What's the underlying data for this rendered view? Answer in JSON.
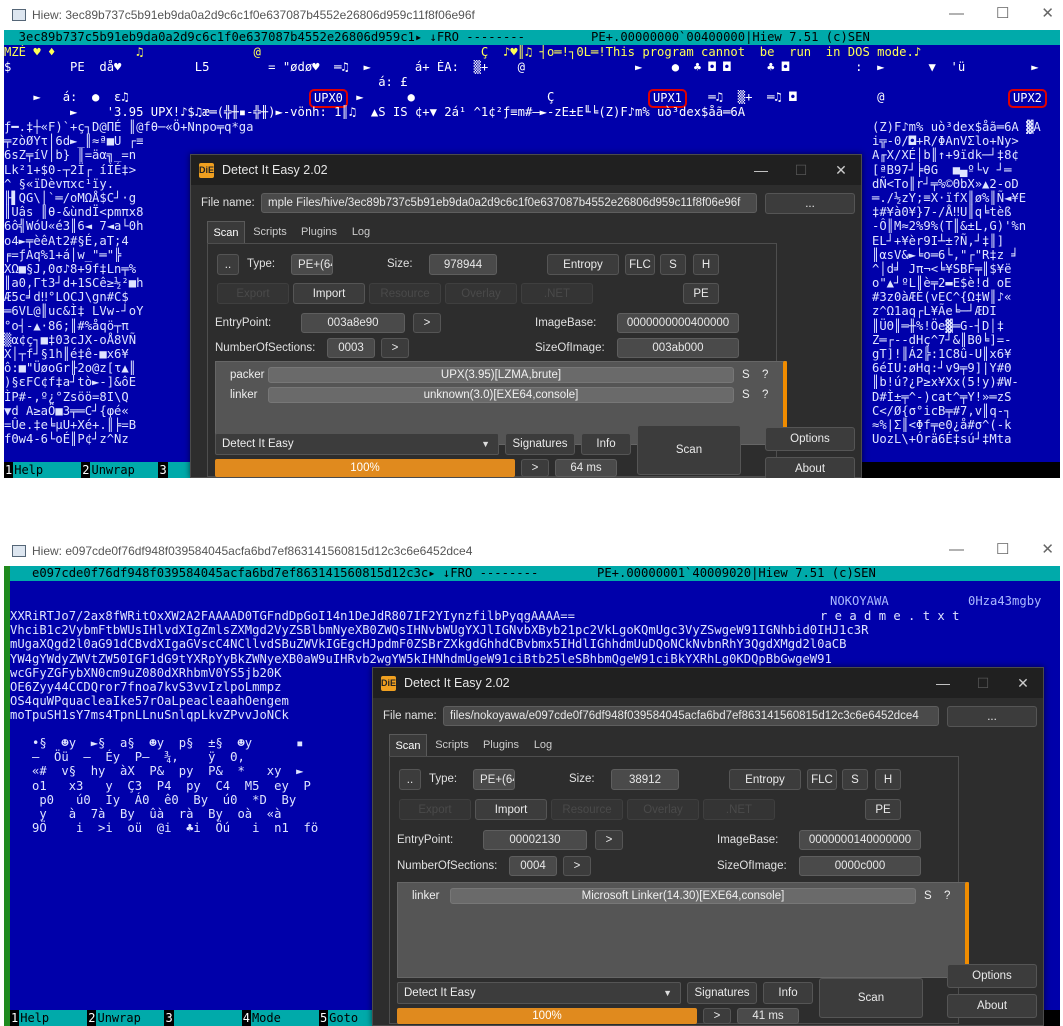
{
  "panel1": {
    "window_title": "Hiew: 3ec89b737c5b91eb9da0a2d9c6c1f0e637087b4552e26806d959c11f8f06e96f",
    "hiew_header": "  3ec89b737c5b91eb9da0a2d9c6c1f0e637087b4552e26806d959c1▸ ↓FRO --------         PE+.00000000`00400000|Hiew 7.51 (c)SEN",
    "hiew_lines": [
      "MZÉ ♥ ♦           ♫               @                              Ç  ♪♥║♫ ┤o═!┐0L═!This program cannot  be  run  in DOS mode.♪",
      "$        PE  då♥          L5        = \"ødø♥  ═♫  ►      á+ ÉA:  ▒+    @               ►    ●  ♣ ◘ ◘     ♣ ◘         :  ►      ▼  'ü         ►",
      "                                                   á: £"
    ],
    "upx_labels": [
      "UPX0",
      "UPX1",
      "UPX2"
    ],
    "upx_line": "    ►   á:  ●  ε♫                           á+  ►      ●                  Ç                     ═♫  ▒+  ═♫ ◘           @",
    "garbage_line": "         ►    '3.95 UPX!♪$♫æ═(╬╫▪-╬╫)►-vönh: 1║♫  ▲S IS ¢+▼ 2á¹ ^1¢²ƒ≡m#—►-zE±E╙╘(Z)F♪m% uò³dex$åã═6A",
    "garbage_left": [
      "ƒ━.‡┼«F)`+ç┐D@ΠÉ ║@fθ─«Ö+Nnpo╤q*ga",
      "╤zòØYτ│6d►_║≈ª■U ┌≡",
      "6sZ╤íV│b} ║=äα╗_=n",
      "Lk²1+$0-┬2Ï┌ íÌÉ‡>",
      "^ §«ïDèvπxc¹ïy.",
      "╟▌QG\\│`═/oMΩÅ$C┘·g",
      "║Uâs ║θ-&ùndÏ<pmπx8",
      "6ô╣WóU«é3║6◄ 7◄a└0h",
      "o4►╤èêAt2#§É,aT;4",
      "╒=ƒAq%1+á│w_\"═\"╠",
      "XΩ■§J,0σ♪8+9f‡Ln╤%",
      "║a0,Γt3┘d+1SCê≥½²■h",
      "Æ5c╛d‼°LOCJ\\gn#C$",
      "═6VL@║uc&Ì‡ LVw-┘oY",
      "°o┤-▲·86;║#%åqö┬π",
      "▒α¢ç┐■‡03cJX-oÅ8VÑ",
      "X│┬f┘§1h║é‡ê-■x6¥",
      "ô:■\"ÜøoGr╟2o@z[τ▲║",
      ")§εFC¢f‡a┘tò►-]&ôE",
      "ÌP#-,º¿°Zsöö=8I\\Q",
      "▼d A≥aÖ■3╤═C┘{φé«",
      "=Ûe.‡e╘µU+Xé+.║╞=B",
      "fΘw4-6└οÉ║P¢┘z^Nz"
    ],
    "garbage_right": [
      "(Z)F♪m% uò³dex$åã═6A ▓A",
      "i╦-0/◘+R/ΦAnVΣlo+Ny>",
      "A╓X/XÉ│b║↑+9ïdk─┘‡8¢",
      "[ªB97┘╞θG  ■▄º└v ┘═",
      "dÑ<To║r┘╤%©ΘbX»▲2-oD",
      "═./½zY;≡X·ïfX║ø%║Ñ◄¥E",
      "‡#¥à0¥}7-/Å‼U║q╘tèß",
      "-Ô║M≈2%9%(T║&±L,G)'%n",
      "EL┘+¥èr9I┴±?Ñ,┘‡║]",
      "║αsV&►╘o═6└,\"┌\"R‡z ╛",
      "^│d╛ Jπ¬<╘¥SBF╤║$¥ë",
      "o\"▲┘ºL║è╤2▬E$è!d oE",
      "#3z0àÆÉ(vEC^{Ω‡W║♪«",
      "z^Ω1aq┌L¥Ãe╘─┘ÆDI",
      "║ÜΘ║═╫%!Öe▓═G-┤D│‡",
      "Z═┌--dHç^7┘&║B0╘]=-",
      "gT]!║Á2╠:1C8û-U║x6¥",
      "6éIU:øHq:┘v9╤9]|Y#Θ",
      "║b!ú?¿P≥x¥Xx(5!y)#W-",
      "D#Ì±╤^-)cat^╤Y!»═zS",
      "C</Ø{σ°icB╤#7,v║q-┐",
      "≈%|Σ║<Φf╤e0¿å#σ^(-k",
      "UozL\\+Órä6É‡sú┘‡Mta"
    ],
    "fkeys": [
      {
        "num": "1",
        "label": "Help"
      },
      {
        "num": "2",
        "label": "Unwrap"
      },
      {
        "num": "3",
        "label": ""
      }
    ],
    "die": {
      "title": "Detect It Easy 2.02",
      "file_name_label": "File name:",
      "file_name_value": "mple Files/hive/3ec89b737c5b91eb9da0a2d9c6c1f0e637087b4552e26806d959c11f8f06e96f",
      "browse_label": "...",
      "tabs": [
        "Scan",
        "Scripts",
        "Plugins",
        "Log"
      ],
      "more_label": "..",
      "type_label": "Type:",
      "type_value": "PE+(64)",
      "size_label": "Size:",
      "size_value": "978944",
      "entropy_label": "Entropy",
      "flc_label": "FLC",
      "s_label": "S",
      "h_label": "H",
      "export_label": "Export",
      "import_label": "Import",
      "resource_label": "Resource",
      "overlay_label": "Overlay",
      "net_label": ".NET",
      "pe_label": "PE",
      "entry_label": "EntryPoint:",
      "entry_value": "003a8e90",
      "arrow_label": ">",
      "imagebase_label": "ImageBase:",
      "imagebase_value": "0000000000400000",
      "sections_label": "NumberOfSections:",
      "sections_value": "0003",
      "sizeofimage_label": "SizeOfImage:",
      "sizeofimage_value": "003ab000",
      "results": [
        {
          "type": "packer",
          "value": "UPX(3.95)[LZMA,brute]",
          "s": "S",
          "q": "?"
        },
        {
          "type": "linker",
          "value": "unknown(3.0)[EXE64,console]",
          "s": "S",
          "q": "?"
        }
      ],
      "options_label": "Options",
      "about_label": "About",
      "engine": "Detect It Easy",
      "signatures_label": "Signatures",
      "info_label": "Info",
      "scan_label": "Scan",
      "progress_text": "100%",
      "progress": 1.0,
      "time_value": "64 ms"
    }
  },
  "panel2": {
    "window_title": "Hiew: e097cde0f76df948f039584045acfa6bd7ef863141560815d12c3c6e6452dce4",
    "hiew_header": "   e097cde0f76df948f039584045acfa6bd7ef863141560815d12c3c▸ ↓FRO --------        PE+.00000001`40009020|Hiew 7.51 (c)SEN",
    "right_names": [
      "NOKOYAWA",
      "0Hza43mgby"
    ],
    "readme_text": "r e a d m e . t x t",
    "base64_lines": [
      "XXRiRTJo7/2ax8fWRitOxXW2A2FAAAAD0TGFndDpGoI14n1DeJdR807IF2YIynzfilbPyqgAAAA==",
      "VhciB1c2VybmFtbWUsIHlvdXIgZmlsZXMgd2VyZSBlbmNyeXB0ZWQsIHNvbWUgYXJlIGNvbXByb21pc2VkLgoKQmUgc3VyZSwgeW91IGNhbid0IHJ1c3R",
      "mUgaXQgd2l0aG91dCBvdXIgaGVscC4NCllvdSBuZWVkIGEgcHJpdmF0ZSBrZXkgdGhhdCBvbmx5IHdlIGhhdmUuDQoNCkNvbnRhY3QgdXMgd2l0aCB",
      "YW4gYWdyZWVtZW50IGF1dG9tYXRpYyBkZWNyeXB0aW9uIHRvb2wgYW5kIHNhdmUgeW91ciBtb25leSBhbmQgeW91ciBkYXRhLg0KDQpBbGwgeW91",
      "wcGFyZGFybXN0cm9uZ080dXRhbmV0YS5jb20K",
      "OE6Zyy44CCDQror7fnoa7kvS3vvIzlpoLmmpz",
      "OS4quWPquacleaIke57rOaLpeacleaahOengem",
      "moTpuSH1sY7ms4TpnLLnuSnlqpLkvZPvvJoNCk"
    ],
    "hex_rows": [
      "   •§  ☻y  ►§  a§  ☻y  p§  ±§  ☻y      ▪",
      "   —  Öü  —  Éy  P—  ¾,    ÿ  Θ,",
      "   «#  v§  hy  àX  P&  py  P&  *   xy  ►",
      "   o1   x3   y  Ç3  P4  py  C4  M5  ey  P",
      "    p0   ú0  Iy  Á0  ê0  By  ú0  *D  By",
      "    y   à  7à  By  ûà  rà  By  oà  «à",
      "   9Ö    i  >i  oü  @i  ♣i  Öú   i  n1  fö"
    ],
    "fkeys": [
      {
        "num": "1",
        "label": "Help"
      },
      {
        "num": "2",
        "label": "Unwrap"
      },
      {
        "num": "3",
        "label": ""
      },
      {
        "num": "4",
        "label": "Mode"
      },
      {
        "num": "5",
        "label": "Goto"
      }
    ],
    "die": {
      "title": "Detect It Easy 2.02",
      "file_name_label": "File name:",
      "file_name_value": "files/nokoyawa/e097cde0f76df948f039584045acfa6bd7ef863141560815d12c3c6e6452dce4",
      "browse_label": "...",
      "tabs": [
        "Scan",
        "Scripts",
        "Plugins",
        "Log"
      ],
      "more_label": "..",
      "type_label": "Type:",
      "type_value": "PE+(64)",
      "size_label": "Size:",
      "size_value": "38912",
      "entropy_label": "Entropy",
      "flc_label": "FLC",
      "s_label": "S",
      "h_label": "H",
      "export_label": "Export",
      "import_label": "Import",
      "resource_label": "Resource",
      "overlay_label": "Overlay",
      "net_label": ".NET",
      "pe_label": "PE",
      "entry_label": "EntryPoint:",
      "entry_value": "00002130",
      "arrow_label": ">",
      "imagebase_label": "ImageBase:",
      "imagebase_value": "0000000140000000",
      "sections_label": "NumberOfSections:",
      "sections_value": "0004",
      "sizeofimage_label": "SizeOfImage:",
      "sizeofimage_value": "0000c000",
      "results": [
        {
          "type": "linker",
          "value": "Microsoft Linker(14.30)[EXE64,console]",
          "s": "S",
          "q": "?"
        }
      ],
      "options_label": "Options",
      "about_label": "About",
      "engine": "Detect It Easy",
      "signatures_label": "Signatures",
      "info_label": "Info",
      "scan_label": "Scan",
      "progress_text": "100%",
      "progress": 1.0,
      "time_value": "41 ms"
    }
  },
  "colors": {
    "hiew_bg": "#0000aa",
    "status_bg": "#00aaaa",
    "die_bg": "#2d2d2d",
    "progress": "#e08a1e",
    "scroll_accent": "#f08c00",
    "highlight": "#e00000"
  }
}
